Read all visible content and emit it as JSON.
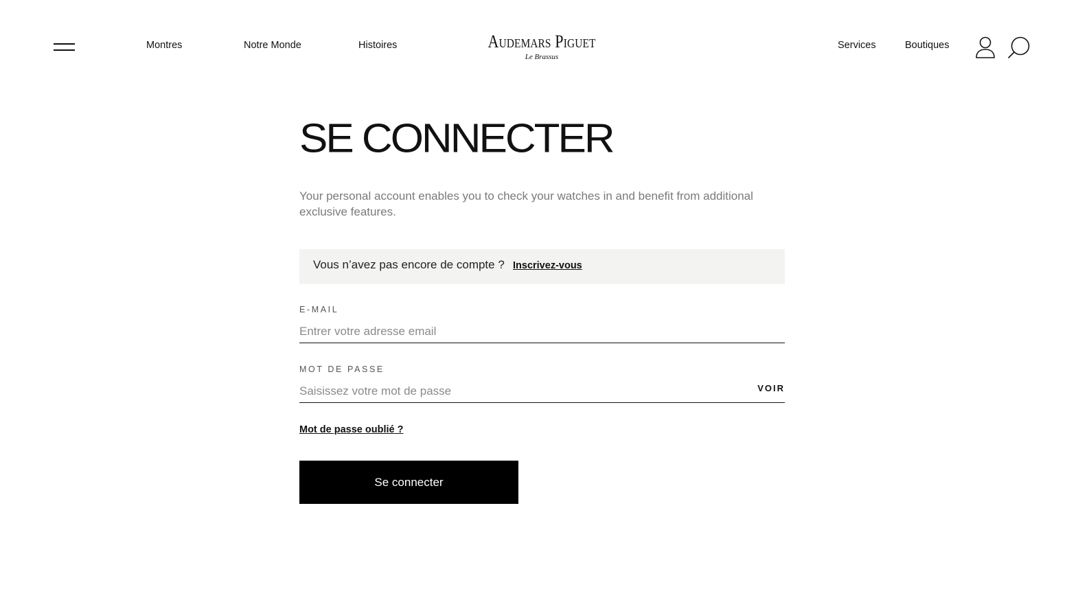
{
  "header": {
    "nav_left": [
      "Montres",
      "Notre Monde",
      "Histoires"
    ],
    "logo": {
      "main": "Audemars Piguet",
      "sub": "Le Brassus"
    },
    "nav_right": [
      "Services",
      "Boutiques"
    ],
    "icons": [
      "menu-icon",
      "user-icon",
      "search-icon"
    ]
  },
  "login": {
    "title": "SE CONNECTER",
    "intro": "Your personal account enables you to check your watches in and benefit from additional exclusive features.",
    "signup_prompt": "Vous n’avez pas encore de compte ?",
    "signup_link": "Inscrivez-vous",
    "email_label": "E-MAIL",
    "email_placeholder": "Entrer votre adresse email",
    "email_value": "",
    "password_label": "MOT DE PASSE",
    "password_placeholder": "Saisissez votre mot de passe",
    "password_value": "",
    "show_password": "VOIR",
    "forgot_password": "Mot de passe oublié ?",
    "submit": "Se connecter"
  }
}
